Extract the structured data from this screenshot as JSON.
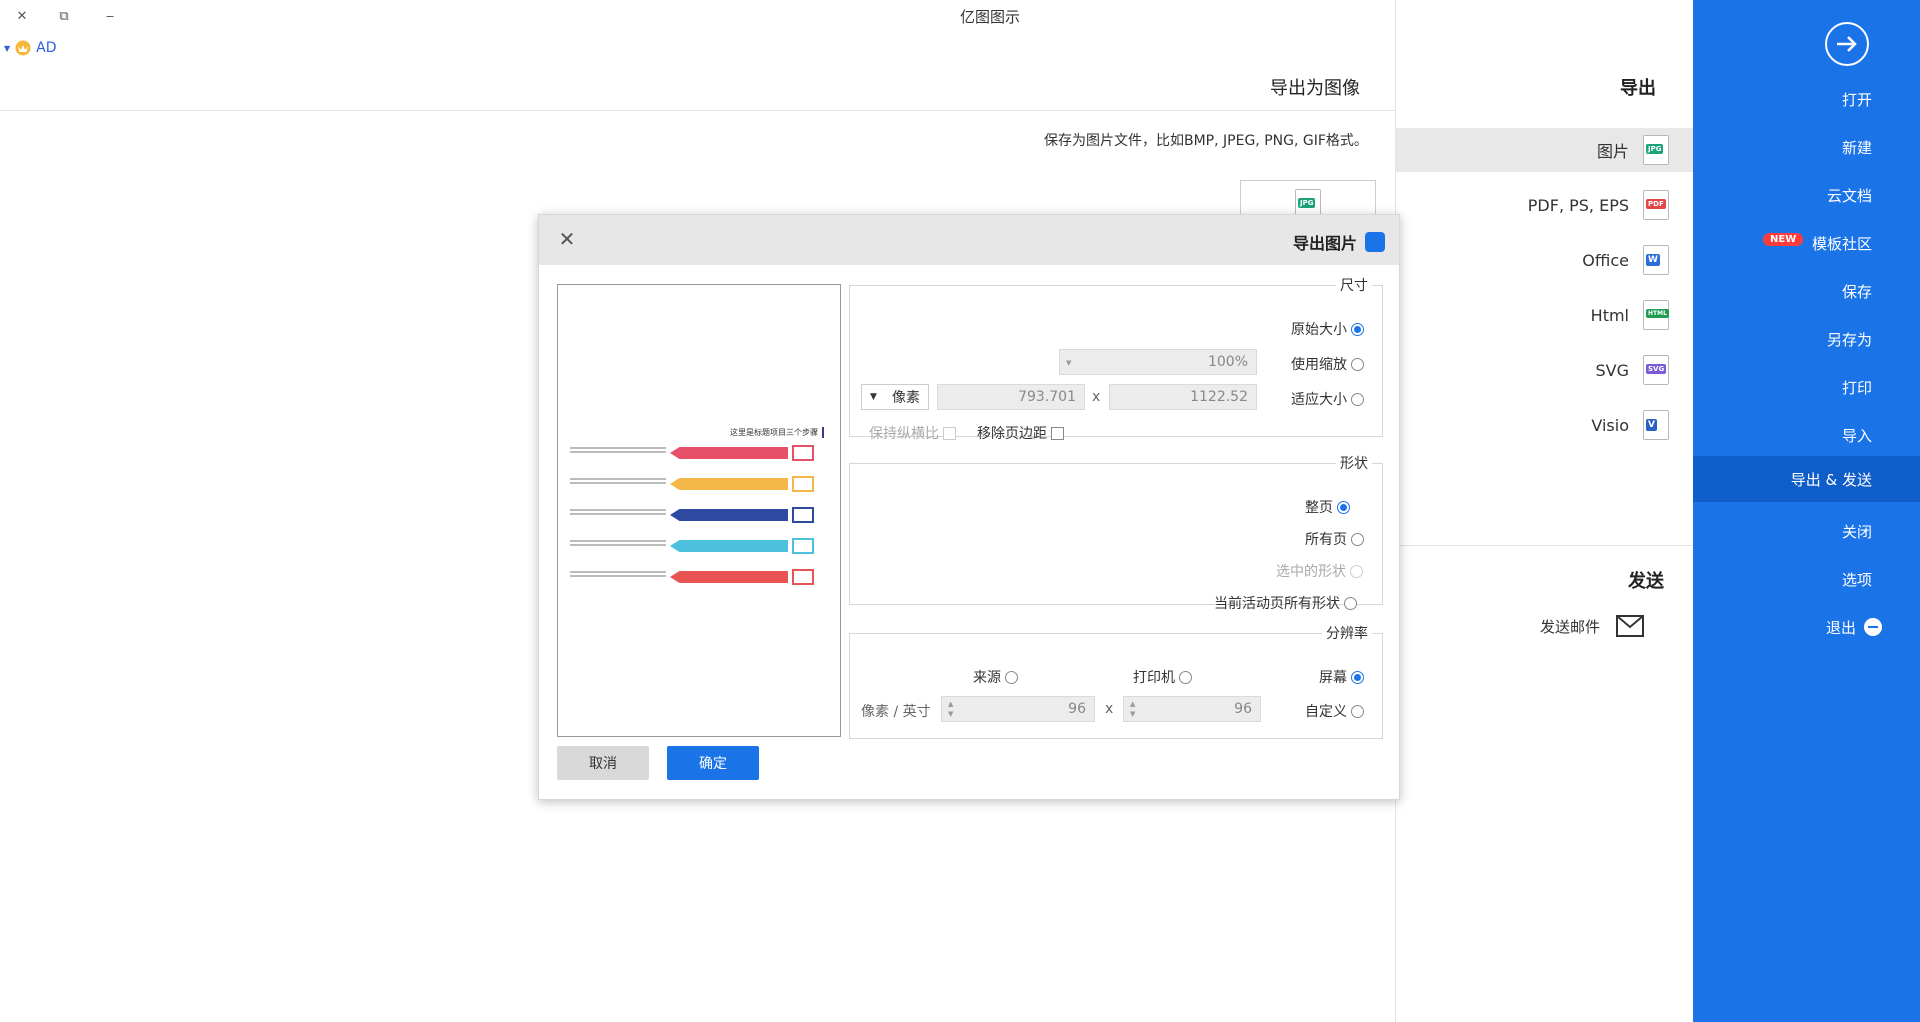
{
  "window": {
    "title": "亿图图示",
    "close_glyph": "✕",
    "restore_glyph": "⧉",
    "minimize_glyph": "‒"
  },
  "user": {
    "name": "AD"
  },
  "sidebar": {
    "items": [
      {
        "label": "打开"
      },
      {
        "label": "新建"
      },
      {
        "label": "云文档"
      },
      {
        "label": "模板社区",
        "badge": "NEW"
      },
      {
        "label": "保存"
      },
      {
        "label": "另存为"
      },
      {
        "label": "打印"
      },
      {
        "label": "导入"
      },
      {
        "label": "导出 & 发送",
        "active": true
      },
      {
        "label": "关闭"
      },
      {
        "label": "选项"
      },
      {
        "label": "退出"
      }
    ]
  },
  "export": {
    "heading": "导出",
    "formats": [
      {
        "label": "图片",
        "icon": "jpg-file-icon",
        "tag": "JPG",
        "color": "#1aa37a",
        "active": true
      },
      {
        "label": "PDF, PS, EPS",
        "icon": "pdf-file-icon",
        "tag": "PDF",
        "color": "#e04848"
      },
      {
        "label": "Office",
        "icon": "word-file-icon",
        "tag": "W",
        "color": "#2b6fd6"
      },
      {
        "label": "Html",
        "icon": "html-file-icon",
        "tag": "HTML",
        "color": "#1f9d55"
      },
      {
        "label": "SVG",
        "icon": "svg-file-icon",
        "tag": "SVG",
        "color": "#7b5bd6"
      },
      {
        "label": "Visio",
        "icon": "visio-file-icon",
        "tag": "V",
        "color": "#2b5fc4"
      }
    ],
    "send_heading": "发送",
    "send_mail": "发送邮件"
  },
  "main": {
    "heading": "导出为图像",
    "description": "保存为图片文件，比如BMP, JPEG, PNG, GIF格式。",
    "thumb_tag": "JPG"
  },
  "dialog": {
    "title": "导出图片",
    "close_glyph": "✕",
    "size": {
      "legend": "尺寸",
      "original": "原始大小",
      "use_zoom": "使用缩放",
      "zoom_value": "100%",
      "fit_size": "适应大小",
      "width": "1122.52",
      "height": "793.701",
      "times": "x",
      "unit": "像素",
      "keep_ratio": "保持纵横比",
      "remove_margin": "移除页边距"
    },
    "shape": {
      "legend": "形状",
      "whole_page": "整页",
      "all_pages": "所有页",
      "selected": "选中的形状",
      "current_active": "当前活动页所有形状"
    },
    "resolution": {
      "legend": "分辨率",
      "screen": "屏幕",
      "printer": "打印机",
      "source": "来源",
      "custom": "自定义",
      "dpi_x": "96",
      "dpi_y": "96",
      "times": "x",
      "unit": "像素 / 英寸"
    },
    "preview": {
      "title": "这里是标题项目三个步骤",
      "steps": [
        {
          "color": "#e8506a"
        },
        {
          "color": "#f5b74a"
        },
        {
          "color": "#2d4aa0"
        },
        {
          "color": "#4cc0dc"
        },
        {
          "color": "#e85454"
        }
      ]
    },
    "ok": "确定",
    "cancel": "取消"
  }
}
